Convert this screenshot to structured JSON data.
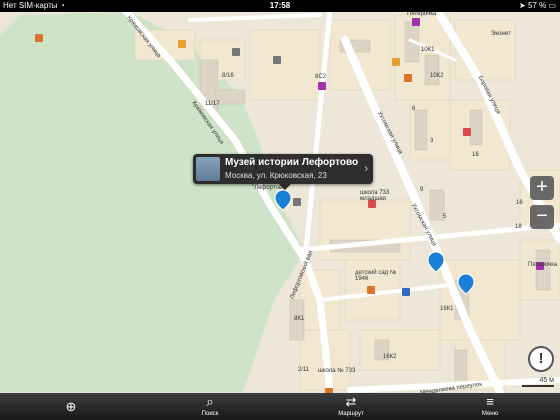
{
  "status_bar": {
    "carrier": "Нет SIM-карты",
    "time": "17:58",
    "battery": "57 %"
  },
  "callout": {
    "title": "Музей истории Лефортово",
    "address": "Москва, ул. Крюковская, 23"
  },
  "map_labels": {
    "street_kryukovskaya": "Крюковская улица",
    "street_kryukovskaya_2": "Крюковская улица",
    "street_lefortovsky": "Лефортовский вал",
    "street_ukhtomskaya": "Ухтомская улица",
    "street_ukhtomskaya_2": "Ухтомская улица",
    "street_borovaya": "Боровая улица",
    "shop_pyaterochka_top": "Пятерочка",
    "shop_pyaterochka_right": "Пятерочка",
    "school_733": "школа 733 младшая",
    "kindergarten_1946": "детский сад № 1946",
    "school_733_bottom": "школа № 733",
    "lefortovo_label": "\"Лефортово\"",
    "house_10k1": "10К1",
    "house_10k2": "10К2",
    "house_8_16": "8/16",
    "house_11_17": "11/17",
    "house_8c2": "8С2",
    "house_16": "16",
    "house_16k1": "16К1",
    "house_16k2": "16К2",
    "house_8k1": "8К1",
    "house_6": "6",
    "house_3": "3",
    "house_9": "9",
    "house_18": "18",
    "house_ekonet": "Эконет",
    "street_bottom": "Менделеева переулок",
    "house_5": "5",
    "house_16b": "16",
    "house_2_11": "2/11"
  },
  "zoom": {
    "in": "+",
    "out": "−"
  },
  "alert_button": "!",
  "scale": "45 м",
  "toolbar": {
    "location_icon": "location-icon",
    "search_label": "Поиск",
    "route_label": "Маршрут",
    "menu_label": "Меню"
  },
  "colors": {
    "park": "#cfe3c8",
    "block": "#f1e6cf",
    "street": "#ffffff",
    "pin": "#1a7fd6",
    "toolbar": "#2a2a2a"
  }
}
